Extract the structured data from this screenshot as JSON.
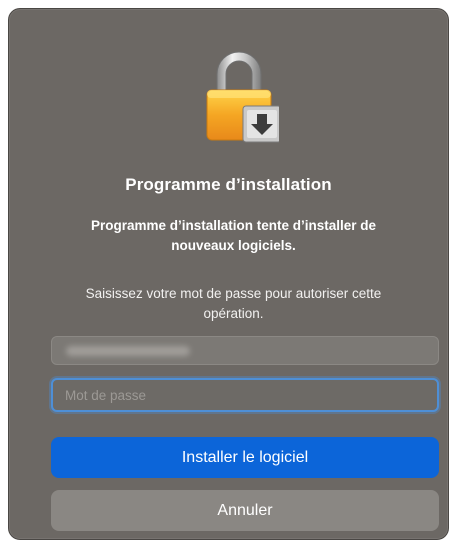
{
  "dialog": {
    "title": "Programme d’installation",
    "message": "Programme d’installation tente d’installer de nouveaux logiciels.",
    "prompt": "Saisissez votre mot de passe pour autoriser cette opération.",
    "icon": "lock-installer-icon"
  },
  "fields": {
    "username_value": "",
    "password_placeholder": "Mot de passe"
  },
  "buttons": {
    "install_label": "Installer le logiciel",
    "cancel_label": "Annuler"
  },
  "colors": {
    "dialog_background": "#6c6864",
    "primary_button": "#0c65d9",
    "secondary_button": "#8a8783",
    "focus_ring": "#4e8fd6"
  }
}
